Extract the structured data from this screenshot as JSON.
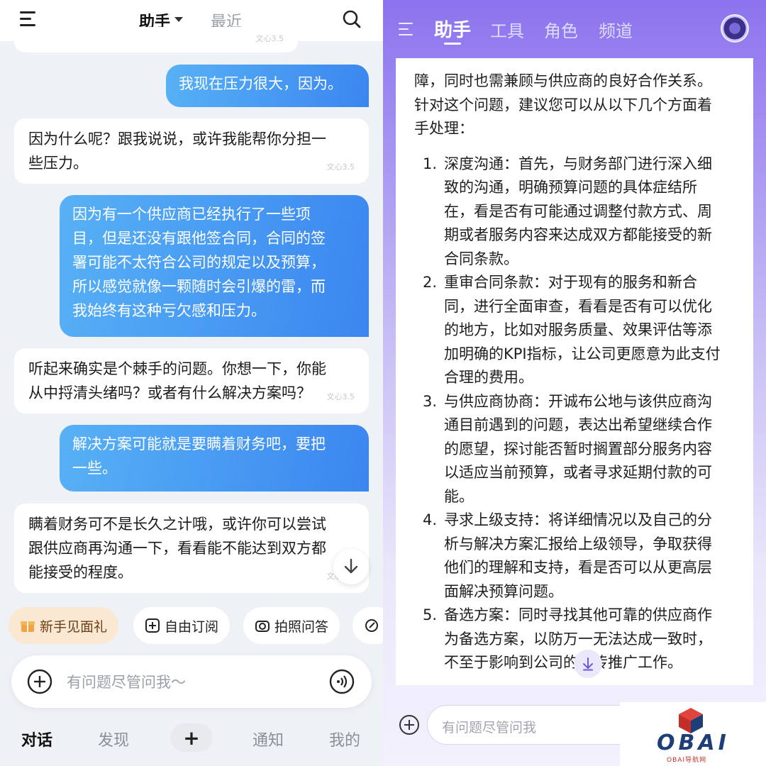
{
  "left": {
    "header": {
      "tab_active": "助手",
      "tab_recent": "最近"
    },
    "model_tag": "文心3.5",
    "messages": [
      {
        "role": "user",
        "text": "我现在压力很大，因为。"
      },
      {
        "role": "ai",
        "lines": [
          "因为什么呢？跟我说说，或许我能帮你分担一",
          "些压力。"
        ]
      },
      {
        "role": "user",
        "lines": [
          "因为有一个供应商已经执行了一些项",
          "目，但是还没有跟他签合同，合同的签",
          "署可能不太符合公司的规定以及预算，",
          "所以感觉就像一颗随时会引爆的雷，而",
          "我始终有这种亏欠感和压力。"
        ]
      },
      {
        "role": "ai",
        "lines": [
          "听起来确实是个棘手的问题。你想一下，你能",
          "从中捋清头绪吗？或者有什么解决方案吗？"
        ]
      },
      {
        "role": "user",
        "lines": [
          "解决方案可能就是要瞒着财务吧，要把",
          "一些。"
        ]
      },
      {
        "role": "ai",
        "lines": [
          "瞒着财务可不是长久之计哦，或许你可以尝试",
          "跟供应商再沟通一下，看看能不能达到双方都",
          "能接受的程度。"
        ]
      }
    ],
    "chips": [
      "新手见面礼",
      "自由订阅",
      "拍照问答"
    ],
    "input_placeholder": "有问题尽管问我～",
    "nav": {
      "chat": "对话",
      "discover": "发现",
      "plus": "+",
      "notify": "通知",
      "mine": "我的"
    }
  },
  "right": {
    "tabs": [
      "助手",
      "工具",
      "角色",
      "频道"
    ],
    "intro_lines": [
      "障，同时也需兼顾与供应商的良好合作关系。",
      "针对这个问题，建议您可以从以下几个方面着",
      "手处理："
    ],
    "list": [
      {
        "num": "1.",
        "lines": [
          "深度沟通：首先，与财务部门进行深入细",
          "致的沟通，明确预算问题的具体症结所",
          "在，看是否有可能通过调整付款方式、周",
          "期或者服务内容来达成双方都能接受的新",
          "合同条款。"
        ]
      },
      {
        "num": "2.",
        "lines": [
          "重审合同条款：对于现有的服务和新合",
          "同，进行全面审查，看看是否有可以优化",
          "的地方，比如对服务质量、效果评估等添",
          "加明确的KPI指标，让公司更愿意为此支付",
          "合理的费用。"
        ]
      },
      {
        "num": "3.",
        "lines": [
          "与供应商协商：开诚布公地与该供应商沟",
          "通目前遇到的问题，表达出希望继续合作",
          "的愿望，探讨能否暂时搁置部分服务内容",
          "以适应当前预算，或者寻求延期付款的可",
          "能。"
        ]
      },
      {
        "num": "4.",
        "lines": [
          "寻求上级支持：将详细情况以及自己的分",
          "析与解决方案汇报给上级领导，争取获得",
          "他们的理解和支持，看是否可以从更高层",
          "面解决预算问题。"
        ]
      },
      {
        "num": "5.",
        "lines": [
          "备选方案：同时寻找其他可靠的供应商作",
          "为备选方案，以防万一无法达成一致时，",
          "不至于影响到公司的宣传推广工作。"
        ]
      }
    ],
    "input_placeholder": "有问题尽管问我"
  },
  "watermark": {
    "brand": "OBAI",
    "sub": "OBAI导航网"
  },
  "colors": {
    "user_bubble_start": "#58b1f5",
    "user_bubble_end": "#3a86f0",
    "right_header_purple": "#8c73ee",
    "gift_chip_bg": "#fbe8d2"
  }
}
